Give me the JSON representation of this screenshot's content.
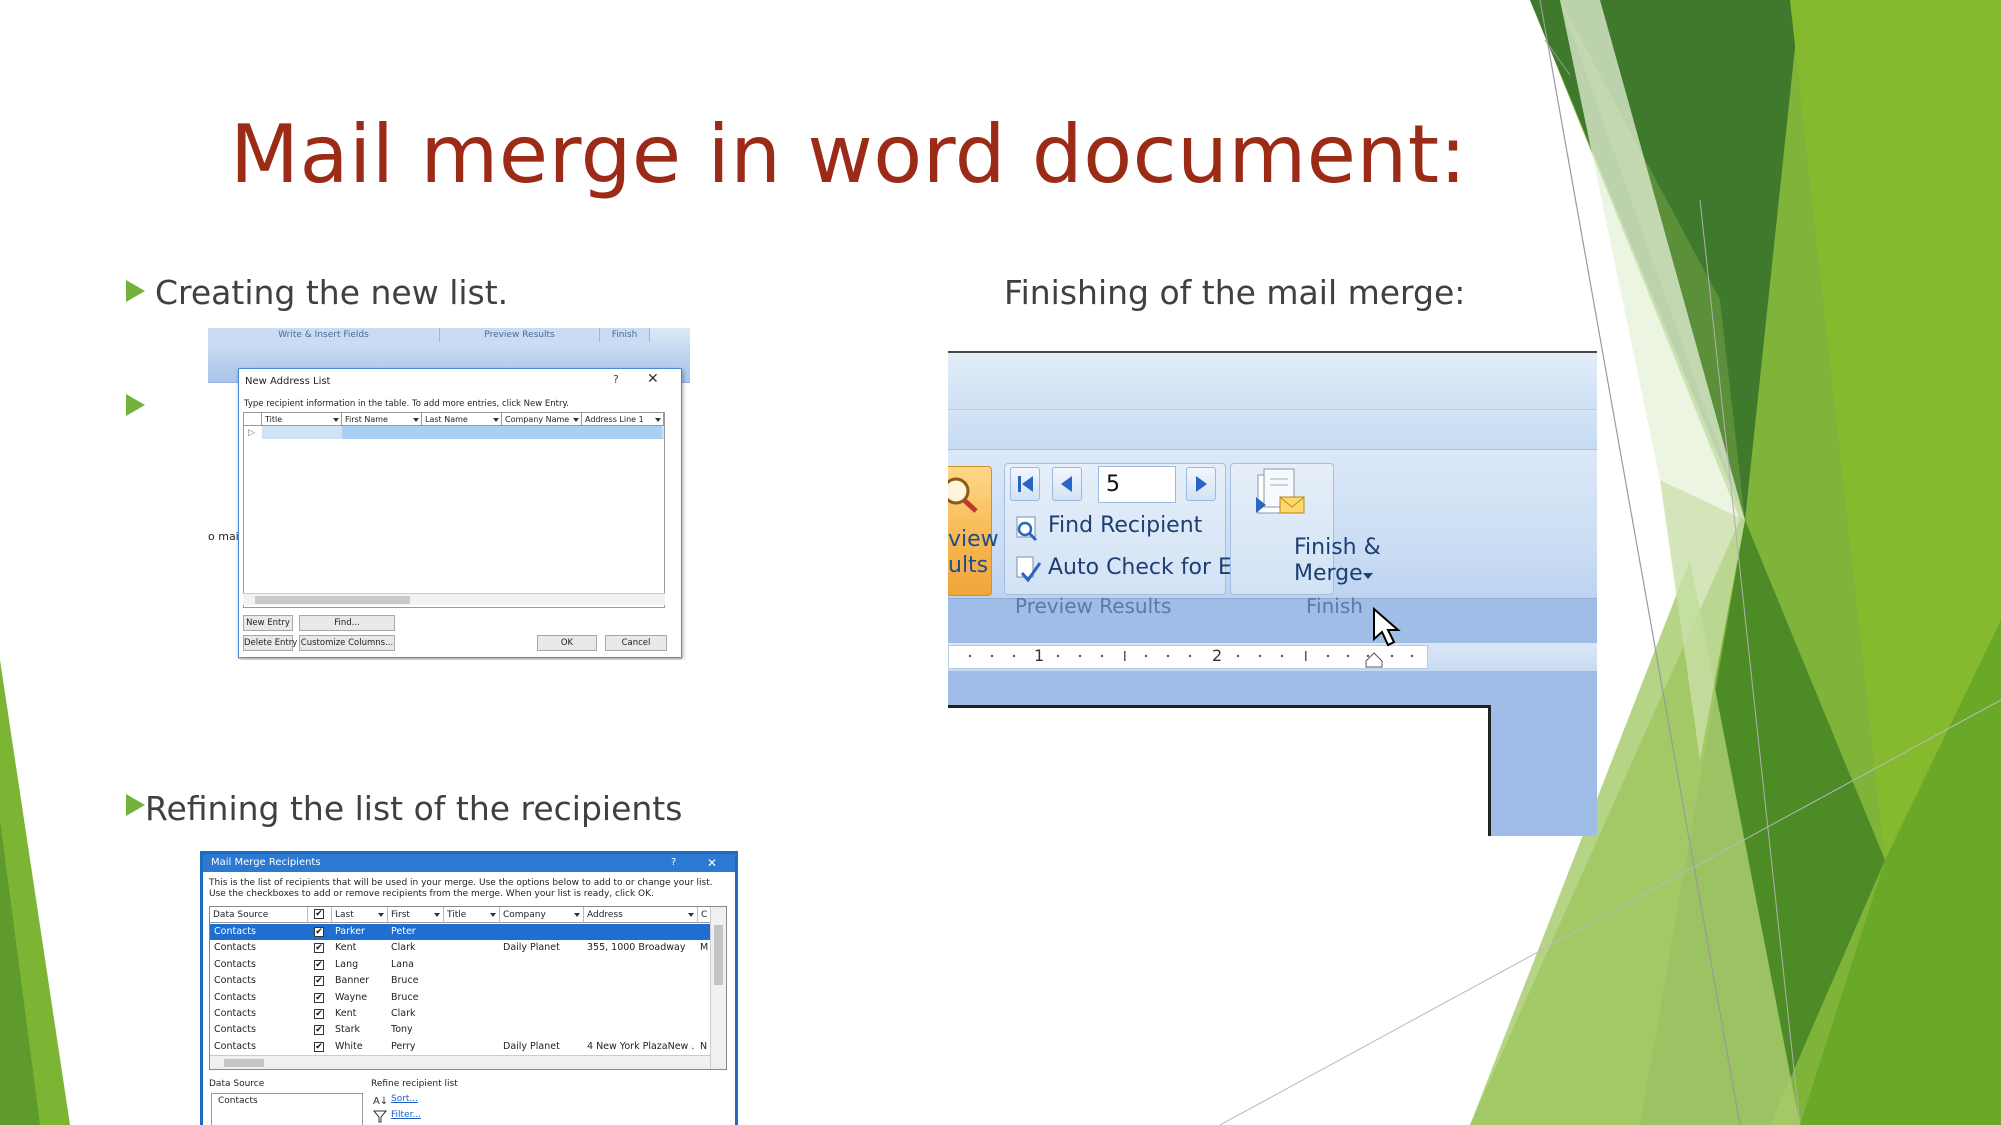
{
  "slide": {
    "title": "Mail merge in word document:",
    "bullets": [
      {
        "text": "Creating the new list."
      },
      {
        "text": ""
      },
      {
        "text": "Refining the list of the recipients"
      }
    ],
    "right_caption": "Finishing of the mail merge:",
    "colors": {
      "title": "#9b2a16",
      "text": "#404040",
      "accent": "#72b23a"
    }
  },
  "new_address_list": {
    "ribbon_groups": [
      "Write & Insert Fields",
      "Preview Results",
      "Finish"
    ],
    "stray_text": "o mai",
    "title": "New Address List",
    "help_glyph": "?",
    "close_glyph": "✕",
    "instruction": "Type recipient information in the table.  To add more entries, click New Entry.",
    "columns": [
      "Title",
      "First Name",
      "Last Name",
      "Company Name",
      "Address Line 1"
    ],
    "row_marker": "▷",
    "buttons": {
      "new_entry": "New Entry",
      "find": "Find...",
      "delete_entry": "Delete Entry",
      "customize_columns": "Customize Columns...",
      "ok": "OK",
      "cancel": "Cancel"
    }
  },
  "word_ribbon": {
    "preview_results_partial": [
      "view",
      "ults"
    ],
    "record_number": "5",
    "find_recipient": "Find Recipient",
    "auto_check": "Auto Check for Errors",
    "preview_group_label": "Preview Results",
    "finish_merge": [
      "Finish &",
      "Merge"
    ],
    "finish_group_label": "Finish",
    "ruler_numbers": [
      "1",
      "2"
    ],
    "icons": [
      "first-record-icon",
      "previous-record-icon",
      "next-record-icon",
      "last-record-icon",
      "find-recipient-icon",
      "auto-check-icon",
      "finish-merge-icon",
      "mouse-cursor-icon"
    ]
  },
  "mail_merge_recipients": {
    "title": "Mail Merge Recipients",
    "help_glyph": "?",
    "close_glyph": "✕",
    "instruction_1": "This is the list of recipients that will be used in your merge.  Use the options below to add to or change your list.",
    "instruction_2": "Use the checkboxes to add or remove recipients from the merge.  When your list is ready, click OK.",
    "columns": [
      "Data Source",
      "",
      "Last",
      "First",
      "Title",
      "Company",
      "Address",
      "C"
    ],
    "rows": [
      {
        "source": "Contacts",
        "checked": "✔",
        "last": "Parker",
        "first": "Peter",
        "company": "",
        "address": "",
        "extra": ""
      },
      {
        "source": "Contacts",
        "checked": "✔",
        "last": "Kent",
        "first": "Clark",
        "company": "Daily Planet",
        "address": "355, 1000 Broadway",
        "extra": "M"
      },
      {
        "source": "Contacts",
        "checked": "✔",
        "last": "Lang",
        "first": "Lana",
        "company": "",
        "address": "",
        "extra": ""
      },
      {
        "source": "Contacts",
        "checked": "✔",
        "last": "Banner",
        "first": "Bruce",
        "company": "",
        "address": "",
        "extra": ""
      },
      {
        "source": "Contacts",
        "checked": "✔",
        "last": "Wayne",
        "first": "Bruce",
        "company": "",
        "address": "",
        "extra": ""
      },
      {
        "source": "Contacts",
        "checked": "✔",
        "last": "Kent",
        "first": "Clark",
        "company": "",
        "address": "",
        "extra": ""
      },
      {
        "source": "Contacts",
        "checked": "✔",
        "last": "Stark",
        "first": "Tony",
        "company": "",
        "address": "",
        "extra": ""
      },
      {
        "source": "Contacts",
        "checked": "✔",
        "last": "White",
        "first": "Perry",
        "company": "Daily Planet",
        "address": "4 New York PlazaNew ...",
        "extra": "N"
      }
    ],
    "data_source_label": "Data Source",
    "data_source_item": "Contacts",
    "refine_label": "Refine recipient list",
    "sort_link": "Sort...",
    "filter_link": "Filter..."
  }
}
